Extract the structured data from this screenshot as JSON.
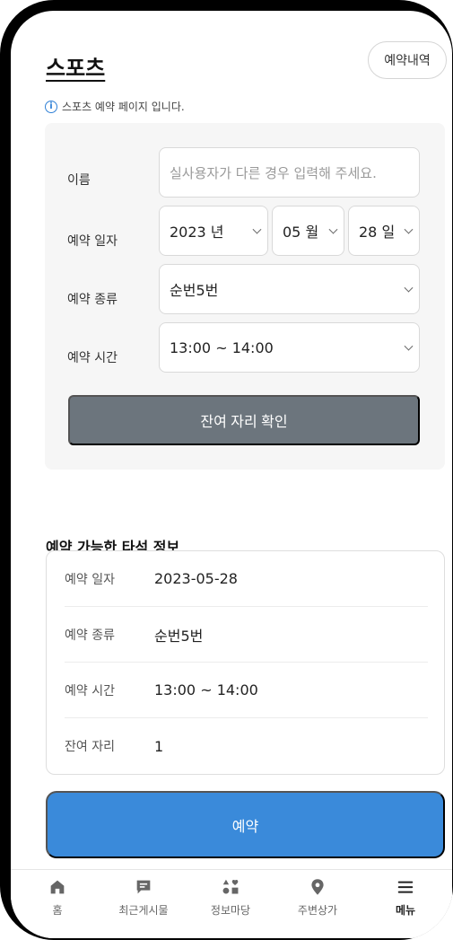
{
  "header": {
    "title": "스포츠",
    "history_button": "예약내역",
    "notice": "스포츠 예약 페이지 입니다."
  },
  "form": {
    "name_label": "이름",
    "name_placeholder": "실사용자가 다른 경우 입력해 주세요.",
    "date_label": "예약 일자",
    "year_value": "2023 년",
    "month_value": "05 월",
    "day_value": "28 일",
    "type_label": "예약 종류",
    "type_value": "순번5번",
    "time_label": "예약 시간",
    "time_value": "13:00 ~ 14:00",
    "check_button": "잔여 자리 확인"
  },
  "result": {
    "title": "예약 가능한 타석 정보",
    "rows": [
      {
        "label": "예약 일자",
        "value": "2023-05-28"
      },
      {
        "label": "예약 종류",
        "value": "순번5번"
      },
      {
        "label": "예약 시간",
        "value": "13:00 ~ 14:00"
      },
      {
        "label": "잔여 자리",
        "value": "1"
      }
    ]
  },
  "reserve_button": "예약",
  "nav": {
    "items": [
      {
        "label": "홈",
        "icon": "home-icon"
      },
      {
        "label": "최근게시물",
        "icon": "message-icon"
      },
      {
        "label": "정보마당",
        "icon": "shapes-icon"
      },
      {
        "label": "주변상가",
        "icon": "location-pin-icon"
      },
      {
        "label": "메뉴",
        "icon": "hamburger-menu-icon"
      }
    ],
    "active_index": 4
  },
  "colors": {
    "accent": "#3a8ada",
    "secondary_button": "#6c757d",
    "panel_bg": "#f6f6f6",
    "info_icon": "#2f80d6"
  }
}
